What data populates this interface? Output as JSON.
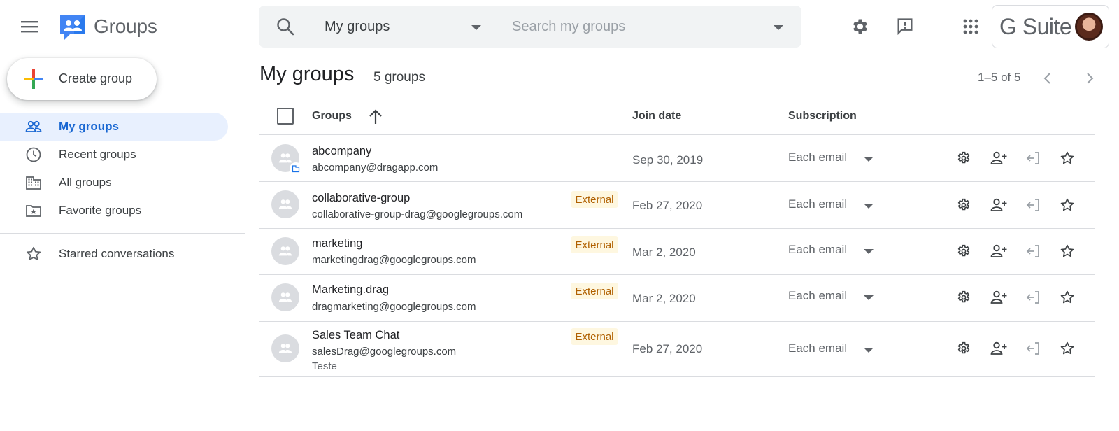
{
  "header": {
    "app_name": "Groups",
    "search_scope": "My groups",
    "search_placeholder": "Search my groups",
    "brand": "G Suite",
    "icons": [
      "menu-icon",
      "groups-logo-icon",
      "search-icon",
      "settings-icon",
      "feedback-icon",
      "apps-grid-icon"
    ]
  },
  "sidebar": {
    "create_label": "Create group",
    "items": [
      {
        "label": "My groups",
        "icon": "people-icon",
        "active": true
      },
      {
        "label": "Recent groups",
        "icon": "clock-icon",
        "active": false
      },
      {
        "label": "All groups",
        "icon": "building-icon",
        "active": false
      },
      {
        "label": "Favorite groups",
        "icon": "folder-star-icon",
        "active": false
      },
      {
        "label": "Starred conversations",
        "icon": "star-icon",
        "active": false
      }
    ]
  },
  "main": {
    "title": "My groups",
    "count": "5 groups",
    "pagination": "1–5 of 5",
    "columns": {
      "groups": "Groups",
      "join_date": "Join date",
      "subscription": "Subscription"
    },
    "rows": [
      {
        "name": "abcompany",
        "email": "abcompany@dragapp.com",
        "badge": "",
        "join_date": "Sep 30, 2019",
        "subscription": "Each email",
        "description": ""
      },
      {
        "name": "collaborative-group",
        "email": "collaborative-group-drag@googlegroups.com",
        "badge": "External",
        "join_date": "Feb 27, 2020",
        "subscription": "Each email",
        "description": ""
      },
      {
        "name": "marketing",
        "email": "marketingdrag@googlegroups.com",
        "badge": "External",
        "join_date": "Mar 2, 2020",
        "subscription": "Each email",
        "description": ""
      },
      {
        "name": "Marketing.drag",
        "email": "dragmarketing@googlegroups.com",
        "badge": "External",
        "join_date": "Mar 2, 2020",
        "subscription": "Each email",
        "description": ""
      },
      {
        "name": "Sales Team Chat",
        "email": "salesDrag@googlegroups.com",
        "badge": "External",
        "join_date": "Feb 27, 2020",
        "subscription": "Each email",
        "description": "Teste"
      }
    ]
  },
  "colors": {
    "accent_blue": "#1967d2",
    "active_bg": "#e8f0fe",
    "external_bg": "#fef7e0",
    "external_text": "#b06000"
  }
}
